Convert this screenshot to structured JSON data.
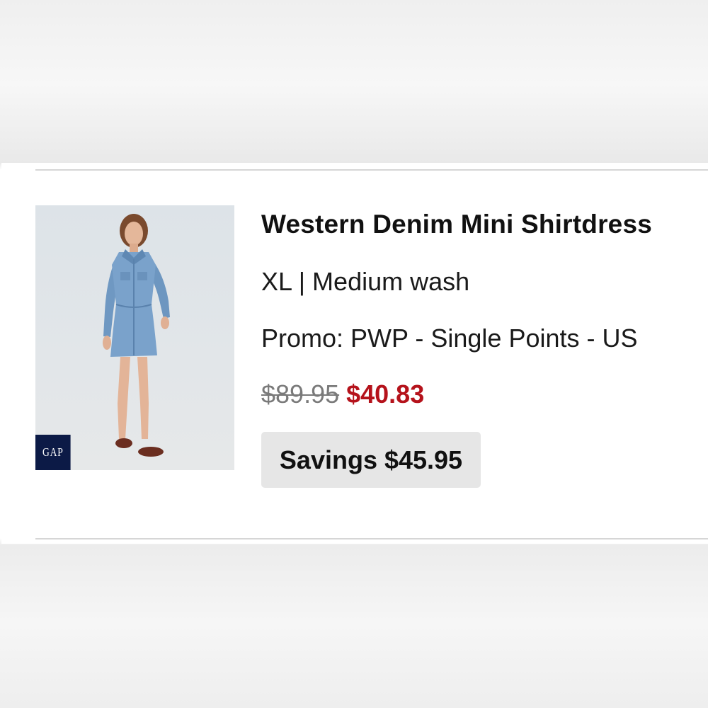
{
  "product": {
    "title": "Western Denim Mini Shirtdress",
    "variant": "XL | Medium wash",
    "promo": "Promo: PWP - Single Points - US",
    "original_price": "$89.95",
    "sale_price": "$40.83",
    "savings": "Savings $45.95",
    "brand_logo_text": "GAP"
  },
  "colors": {
    "sale_price": "#b5121b",
    "original_price": "#7a7a7a",
    "savings_badge_bg": "#e6e6e6",
    "brand_logo_bg": "#0c1a46",
    "denim": "#6f98c2"
  }
}
